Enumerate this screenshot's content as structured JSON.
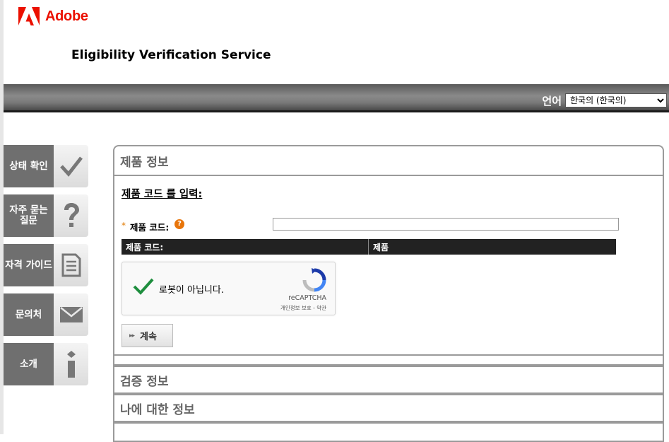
{
  "brand": {
    "name": "Adobe",
    "color": "#eb1000"
  },
  "service_title": "Eligibility Verification Service",
  "language": {
    "label": "언어",
    "selected": "한국의 (한국의)"
  },
  "nav": [
    {
      "label": "상태 확인",
      "icon": "check-icon"
    },
    {
      "label": "자주 묻는 질문",
      "icon": "question-icon"
    },
    {
      "label": "자격 가이드",
      "icon": "document-icon"
    },
    {
      "label": "문의처",
      "icon": "envelope-icon"
    },
    {
      "label": "소개",
      "icon": "info-icon"
    }
  ],
  "product_section": {
    "title": "제품 정보",
    "enter_label": "제품 코드 를 입력:",
    "required_mark": "*",
    "code_label": "제품 코드:",
    "help_glyph": "?",
    "table_headers": [
      "제품 코드:",
      "제품"
    ]
  },
  "recaptcha": {
    "text": "로봇이 아닙니다.",
    "brand": "reCAPTCHA",
    "links": "개인정보 보호 - 약관"
  },
  "continue_button": {
    "arrow": "▸▸",
    "label": "계속"
  },
  "verification_section": {
    "title": "검증 정보"
  },
  "about_me_section": {
    "title": "나에 대한 정보"
  }
}
